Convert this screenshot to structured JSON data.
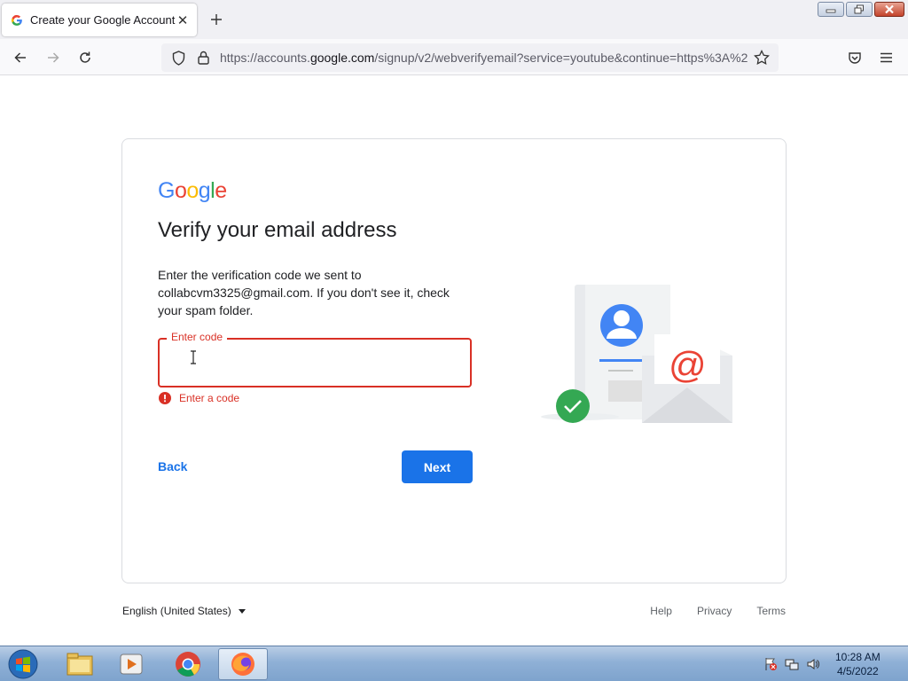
{
  "browser": {
    "tab_title": "Create your Google Account",
    "url_prefix": "https://accounts.",
    "url_domain": "google.com",
    "url_rest": "/signup/v2/webverifyemail?service=youtube&continue=https%3A%2F"
  },
  "page": {
    "logo": [
      "G",
      "o",
      "o",
      "g",
      "l",
      "e"
    ],
    "logo_colors": [
      "#4285F4",
      "#EA4335",
      "#FBBC05",
      "#4285F4",
      "#34A853",
      "#EA4335"
    ],
    "headline": "Verify your email address",
    "description": "Enter the verification code we sent to collabcvm3325@gmail.com. If you don't see it, check your spam folder.",
    "code_field": {
      "label": "Enter code",
      "value": ""
    },
    "error_text": "Enter a code",
    "back_label": "Back",
    "next_label": "Next"
  },
  "footer": {
    "language": "English (United States)",
    "links": [
      "Help",
      "Privacy",
      "Terms"
    ]
  },
  "taskbar": {
    "time": "10:28 AM",
    "date": "4/5/2022"
  },
  "colors": {
    "accent": "#1a73e8",
    "error": "#d93025",
    "success": "#34a853"
  }
}
